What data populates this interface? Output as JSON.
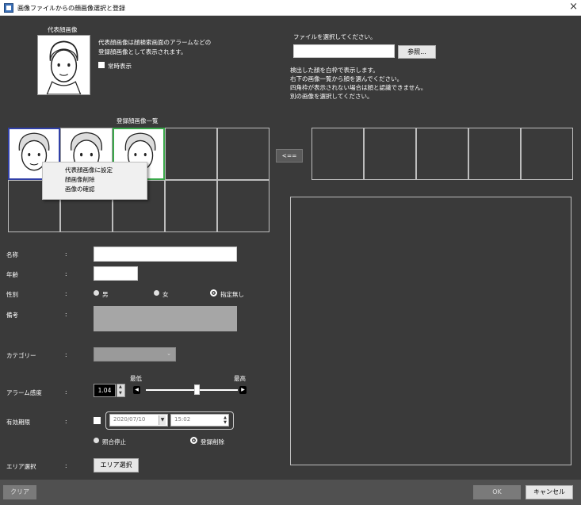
{
  "window": {
    "title": "画像ファイルからの顔画像選択と登録",
    "close": "×"
  },
  "rep": {
    "header": "代表顔画像",
    "desc1": "代表顔画像は顔検索画面のアラームなどの",
    "desc2": "登録顔画像として表示されます。",
    "always_label": "常時表示"
  },
  "file": {
    "label": "ファイルを選択してください。",
    "path_value": "",
    "browse": "参照...",
    "info1": "検出した顔を白枠で表示します。",
    "info2": "右下の画像一覧から顔を選んでください。",
    "info3": "四角枠が表示されない場合は顔と認識できません。",
    "info4": "別の画像を選択してください。"
  },
  "list_header": "登録顔画像一覧",
  "transfer_btn": "<==",
  "context_menu": [
    "代表顔画像に設定",
    "顔画像削除",
    "画像の確認"
  ],
  "form": {
    "sep": ":",
    "name_label": "名称",
    "name_value": "",
    "age_label": "年齢",
    "age_value": "",
    "gender_label": "性別",
    "gender_options": [
      "男",
      "女",
      "指定無し"
    ],
    "gender_selected": "指定無し",
    "note_label": "備考",
    "note_value": "",
    "category_label": "カテゴリー",
    "category_value": "",
    "alarm_label": "アラーム感度",
    "alarm_low": "最低",
    "alarm_high": "最高",
    "alarm_value": "1.04",
    "alarm_level": 0.56,
    "expiry_label": "有効期限",
    "expiry_date": "2020/07/10",
    "expiry_time": "15:02",
    "expiry_options": [
      "照合停止",
      "登録削除"
    ],
    "expiry_selected": "登録削除",
    "area_label": "エリア選択",
    "area_button": "エリア選択"
  },
  "footer": {
    "clear": "クリア",
    "ok": "OK",
    "cancel": "キャンセル"
  }
}
